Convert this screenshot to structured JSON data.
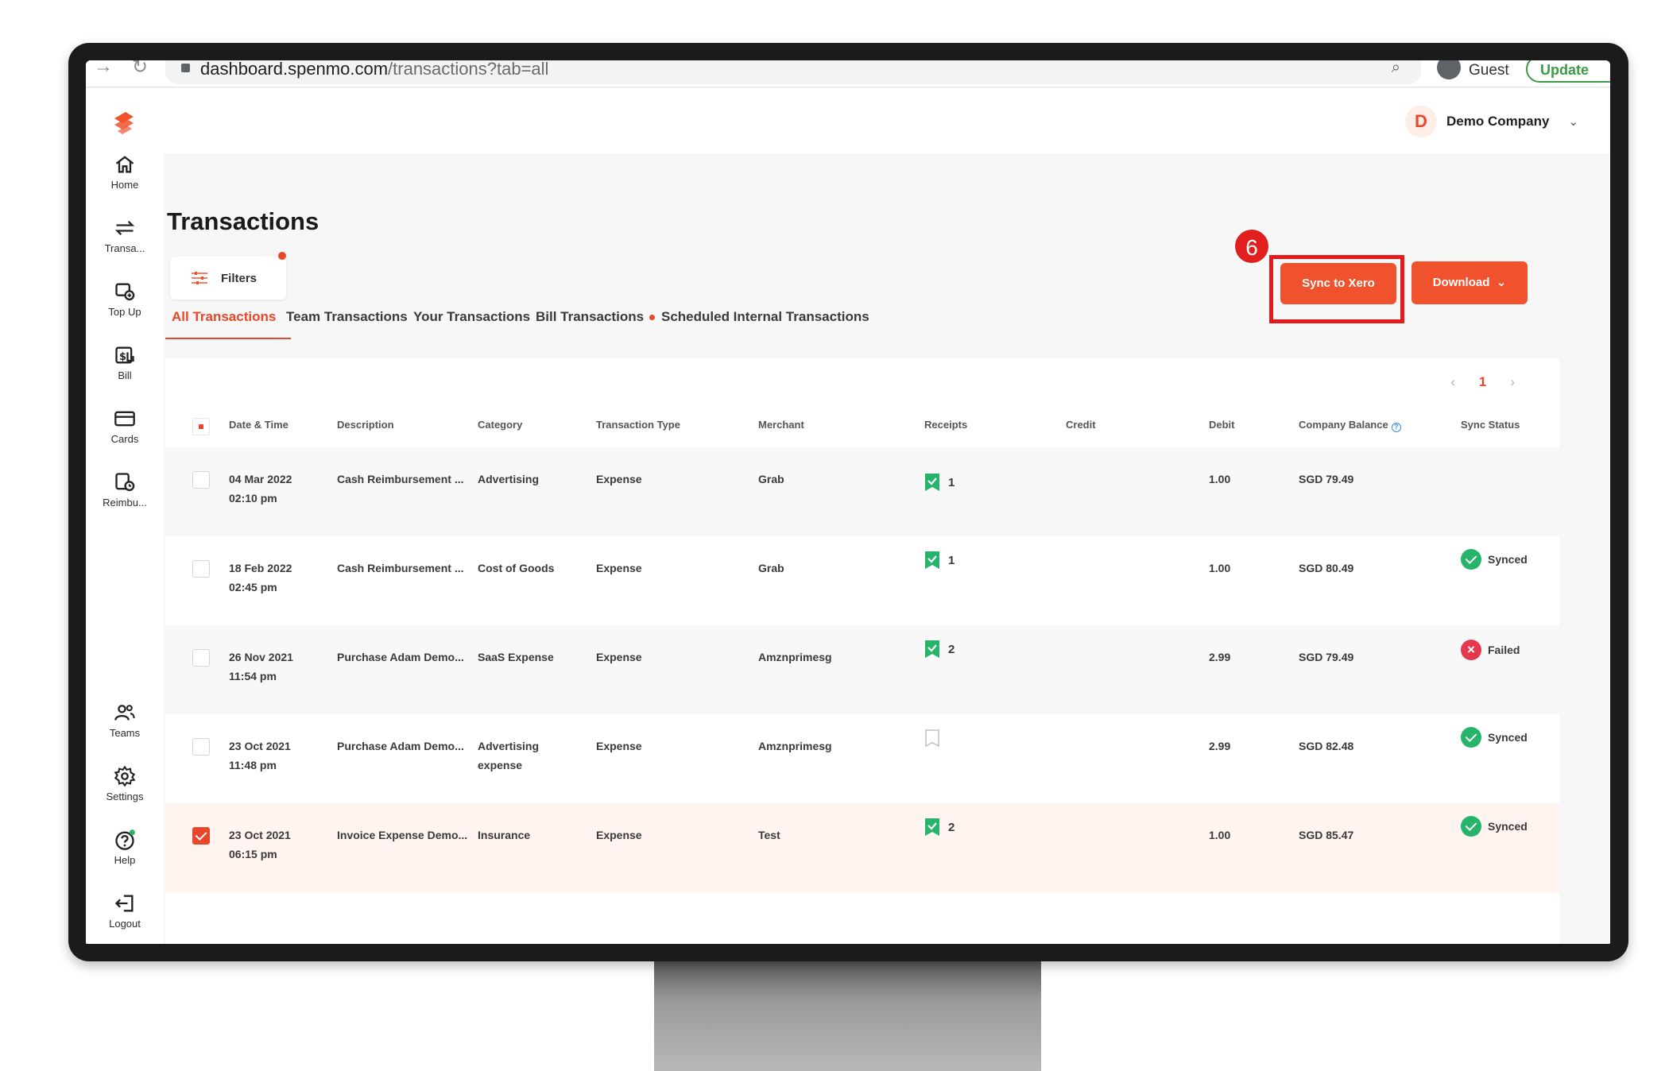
{
  "browser": {
    "url_host": "dashboard.spenmo.com",
    "url_path": "/transactions?tab=all",
    "profile": "Guest",
    "update_label": "Update"
  },
  "header": {
    "company_initial": "D",
    "company_name": "Demo Company"
  },
  "sidebar": {
    "top_items": [
      {
        "label": "Home",
        "icon": "home-icon"
      },
      {
        "label": "Transa...",
        "icon": "transfer-arrows-icon"
      },
      {
        "label": "Top Up",
        "icon": "top-up-icon"
      },
      {
        "label": "Bill",
        "icon": "bill-icon"
      },
      {
        "label": "Cards",
        "icon": "card-icon"
      },
      {
        "label": "Reimbu...",
        "icon": "reimbursement-icon"
      }
    ],
    "bottom_items": [
      {
        "label": "Teams",
        "icon": "teams-icon"
      },
      {
        "label": "Settings",
        "icon": "settings-gear-icon"
      },
      {
        "label": "Help",
        "icon": "help-icon"
      },
      {
        "label": "Logout",
        "icon": "logout-icon"
      }
    ]
  },
  "page": {
    "title": "Transactions",
    "filters_label": "Filters",
    "step_number": "6",
    "sync_label": "Sync to Xero",
    "download_label": "Download"
  },
  "tabs": [
    {
      "label": "All Transactions",
      "active": true
    },
    {
      "label": "Team Transactions"
    },
    {
      "label": "Your Transactions"
    },
    {
      "label": "Bill Transactions",
      "dot": true
    },
    {
      "label": "Scheduled Internal Transactions"
    }
  ],
  "pagination": {
    "current": "1"
  },
  "table": {
    "columns": [
      "Date & Time",
      "Description",
      "Category",
      "Transaction Type",
      "Merchant",
      "Receipts",
      "Credit",
      "Debit",
      "Company Balance",
      "Sync Status"
    ],
    "rows": [
      {
        "date": "04 Mar 2022",
        "time": "02:10 pm",
        "description": "Cash Reimbursement ...",
        "category": "Advertising",
        "category2": "",
        "type": "Expense",
        "merchant": "Grab",
        "receipts": "1",
        "credit": "",
        "debit": "1.00",
        "balance": "SGD 79.49",
        "sync": "",
        "checked": false
      },
      {
        "date": "18 Feb 2022",
        "time": "02:45 pm",
        "description": "Cash Reimbursement ...",
        "category": "Cost of Goods",
        "category2": "",
        "type": "Expense",
        "merchant": "Grab",
        "receipts": "1",
        "credit": "",
        "debit": "1.00",
        "balance": "SGD 80.49",
        "sync": "Synced",
        "checked": false
      },
      {
        "date": "26 Nov 2021",
        "time": "11:54 pm",
        "description": "Purchase Adam Demo...",
        "category": "SaaS Expense",
        "category2": "",
        "type": "Expense",
        "merchant": "Amznprimesg",
        "receipts": "2",
        "credit": "",
        "debit": "2.99",
        "balance": "SGD 79.49",
        "sync": "Failed",
        "checked": false
      },
      {
        "date": "23 Oct 2021",
        "time": "11:48 pm",
        "description": "Purchase Adam Demo...",
        "category": "Advertising",
        "category2": "expense",
        "type": "Expense",
        "merchant": "Amznprimesg",
        "receipts": "",
        "credit": "",
        "debit": "2.99",
        "balance": "SGD 82.48",
        "sync": "Synced",
        "checked": false
      },
      {
        "date": "23 Oct 2021",
        "time": "06:15 pm",
        "description": "Invoice Expense Demo...",
        "category": "Insurance",
        "category2": "",
        "type": "Expense",
        "merchant": "Test",
        "receipts": "2",
        "credit": "",
        "debit": "1.00",
        "balance": "SGD 85.47",
        "sync": "Synced",
        "checked": true
      }
    ]
  },
  "colors": {
    "brand": "#f0522e",
    "accent": "#e8472a",
    "synced": "#26b36a",
    "failed": "#e5384f",
    "highlight": "#e51b1b"
  }
}
